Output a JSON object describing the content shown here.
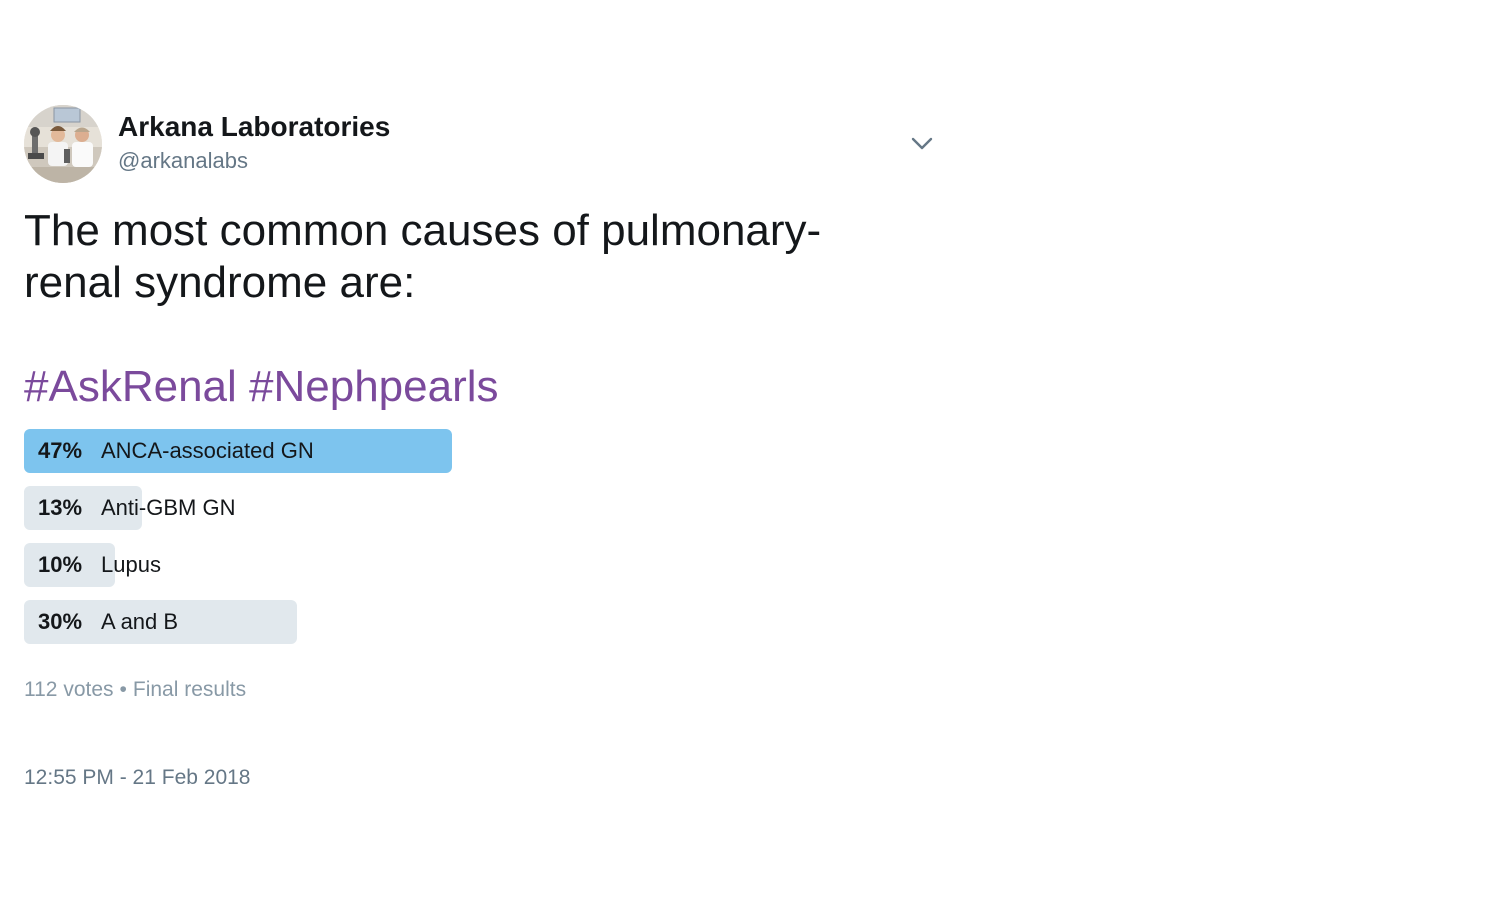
{
  "author": {
    "name": "Arkana Laboratories",
    "handle": "@arkanalabs",
    "avatar_icon": "avatar-photo-lab-scientists"
  },
  "menu_icon": "chevron-down-icon",
  "tweet": {
    "text": "The most common causes of pulmonary-renal syndrome are:",
    "hashtags": [
      "#AskRenal",
      "#Nephpearls"
    ]
  },
  "poll": {
    "options": [
      {
        "percent_label": "47%",
        "label": "ANCA-associated GN",
        "percent": 47
      },
      {
        "percent_label": "13%",
        "label": "Anti-GBM GN",
        "percent": 13
      },
      {
        "percent_label": "10%",
        "label": "Lupus",
        "percent": 10
      },
      {
        "percent_label": "30%",
        "label": "A and B",
        "percent": 30
      }
    ],
    "votes": "112 votes",
    "separator": "•",
    "status": "Final results"
  },
  "timestamp": "12:55 PM - 21 Feb 2018",
  "colors": {
    "winner_bar": "#7dc4ee",
    "other_bar": "#e1e8ed",
    "hashtag": "#7b4a9c",
    "secondary_text": "#657786"
  }
}
